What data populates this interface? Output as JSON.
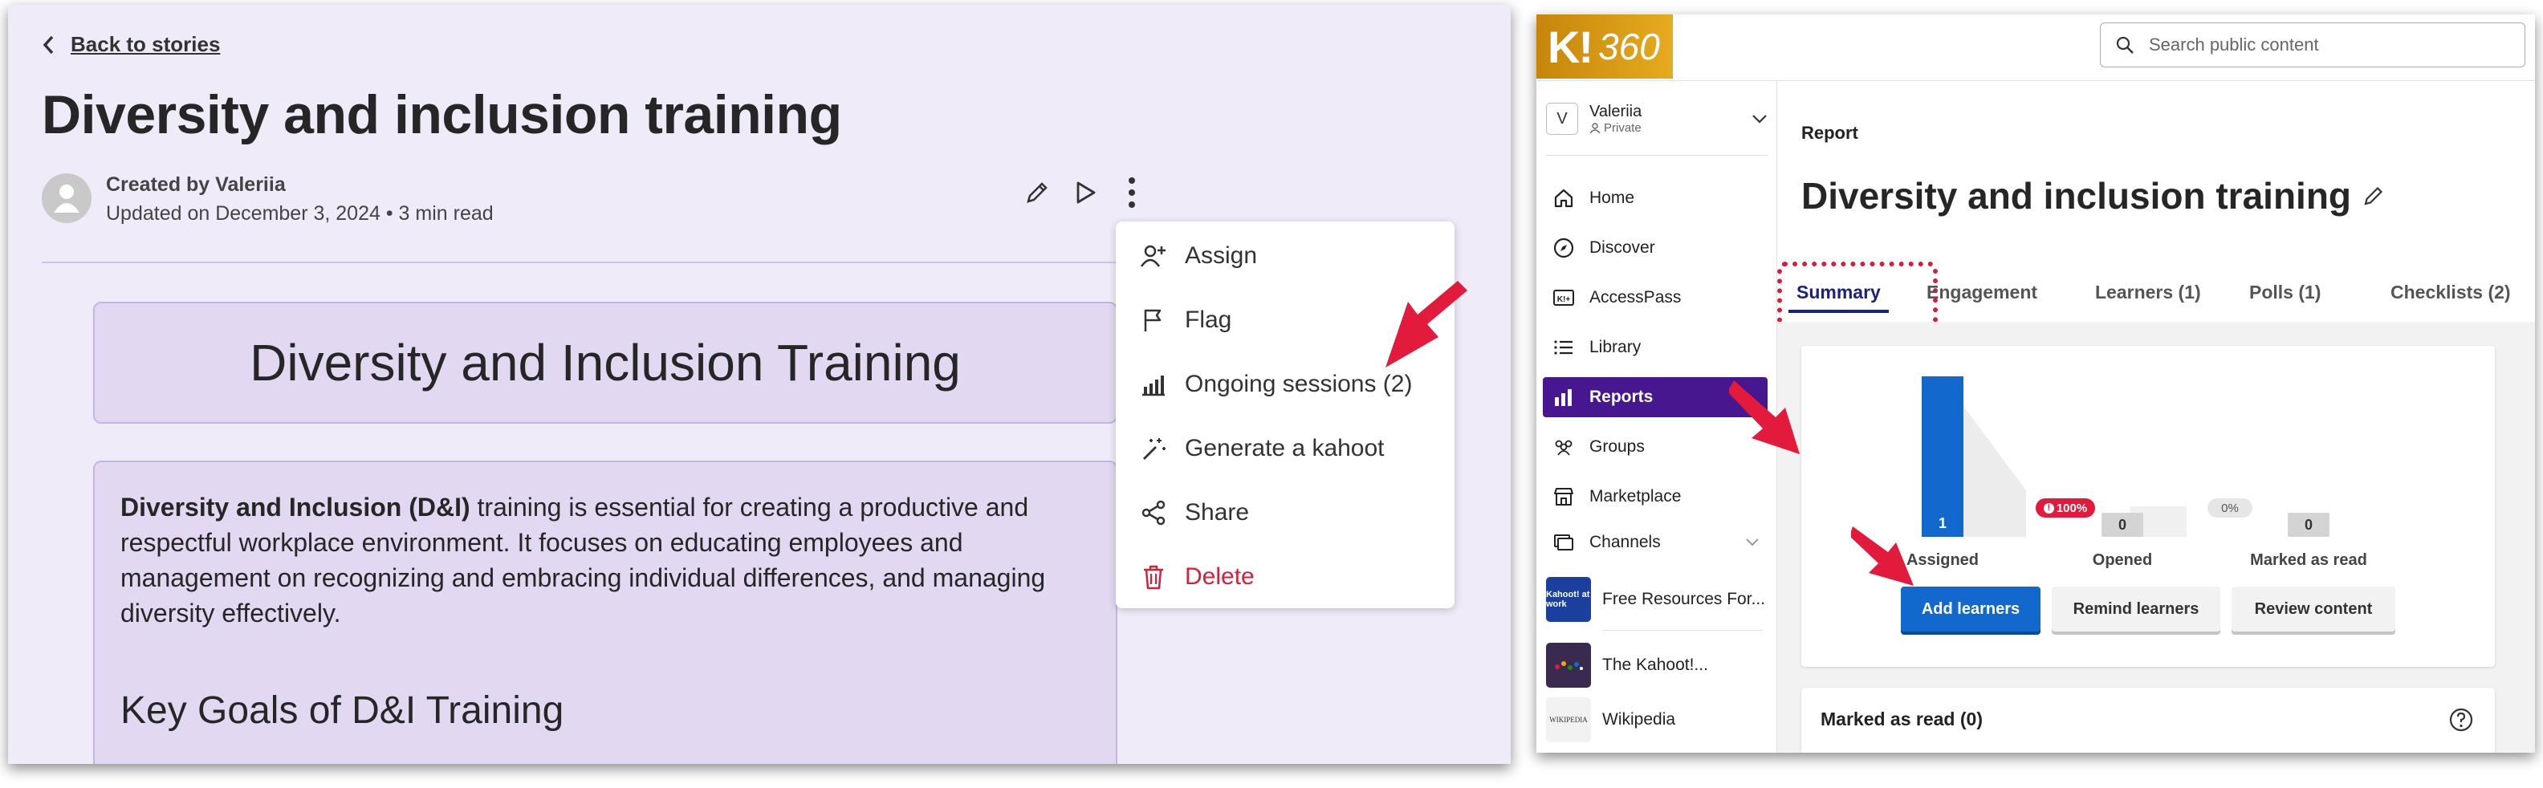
{
  "left": {
    "back_label": "Back to stories",
    "title": "Diversity and inclusion training",
    "created_by": "Created by Valeriia",
    "updated": "Updated on December 3, 2024 • 3 min read",
    "doc_heading": "Diversity and Inclusion Training",
    "paragraph_bold": "Diversity and Inclusion (D&I)",
    "paragraph_rest": " training is essential for creating a productive and respectful workplace environment. It focuses on educating employees and management on recognizing and embracing individual differences, and managing diversity effectively.",
    "subheading": "Key Goals of D&I Training",
    "menu": [
      {
        "label": "Assign",
        "icon": "person-add-icon"
      },
      {
        "label": "Flag",
        "icon": "flag-icon"
      },
      {
        "label": "Ongoing sessions (2)",
        "icon": "bar-chart-icon"
      },
      {
        "label": "Generate a kahoot",
        "icon": "magic-wand-icon"
      },
      {
        "label": "Share",
        "icon": "share-icon"
      },
      {
        "label": "Delete",
        "icon": "trash-icon"
      }
    ],
    "colors": {
      "delete": "#d6203b",
      "accent": "#46178f",
      "arrow": "#e21b3c"
    }
  },
  "right": {
    "logo": {
      "k": "K!",
      "suffix": "360"
    },
    "search_placeholder": "Search public content",
    "account": {
      "initial": "V",
      "name": "Valeriia",
      "visibility": "Private"
    },
    "nav": [
      {
        "label": "Home",
        "icon": "home-icon"
      },
      {
        "label": "Discover",
        "icon": "compass-icon"
      },
      {
        "label": "AccessPass",
        "icon": "accesspass-icon"
      },
      {
        "label": "Library",
        "icon": "list-icon"
      },
      {
        "label": "Reports",
        "icon": "reports-icon"
      },
      {
        "label": "Groups",
        "icon": "groups-icon"
      },
      {
        "label": "Marketplace",
        "icon": "store-icon"
      },
      {
        "label": "Channels",
        "icon": "channels-icon"
      }
    ],
    "resources": [
      {
        "label": "Free Resources For...",
        "thumb": "Kahoot! at work"
      },
      {
        "label": "The Kahoot!...",
        "thumb": ""
      },
      {
        "label": "Wikipedia",
        "thumb": "WIKIPEDIA"
      }
    ],
    "report_label": "Report",
    "report_title": "Diversity and inclusion training",
    "tabs": [
      "Summary",
      "Engagement",
      "Learners (1)",
      "Polls (1)",
      "Checklists (2)"
    ],
    "funnel": [
      {
        "label": "Assigned",
        "value": "1"
      },
      {
        "label": "Opened",
        "value": "0"
      },
      {
        "label": "Marked as read",
        "value": "0"
      }
    ],
    "drop1": "100%",
    "drop2": "0%",
    "buttons": {
      "add": "Add learners",
      "remind": "Remind learners",
      "review": "Review content"
    },
    "marked_read": "Marked as read (0)"
  }
}
